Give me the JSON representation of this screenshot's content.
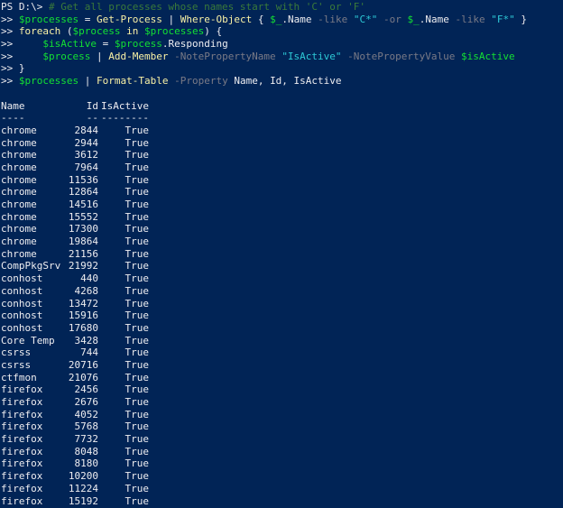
{
  "prompt": {
    "ps": "PS D:\\> ",
    "cont": ">> "
  },
  "lines": {
    "l1_comment": "# Get all processes whose names start with 'C' or 'F'",
    "l2_var": "$processes",
    "l2_eq": " = ",
    "l2_cmd": "Get-Process",
    "l2_pipe": " | ",
    "l2_cmd2": "Where-Object",
    "l2_brace": " { ",
    "l2_pvar": "$_",
    "l2_prop": ".Name ",
    "l2_like": "-like",
    "l2_sp": " ",
    "l2_str1": "\"C*\"",
    "l2_or": " -or ",
    "l2_pvar2": "$_",
    "l2_prop2": ".Name ",
    "l2_like2": "-like",
    "l2_sp2": " ",
    "l2_str2": "\"F*\"",
    "l2_close": " }",
    "l3_kw": "foreach",
    "l3_open": " (",
    "l3_var": "$process",
    "l3_in": " in ",
    "l3_var2": "$processes",
    "l3_close": ") {",
    "l4_indent": "    ",
    "l4_var": "$isActive",
    "l4_eq": " = ",
    "l4_var2": "$process",
    "l4_prop": ".Responding",
    "l5_indent": "    ",
    "l5_var": "$process",
    "l5_pipe": " | ",
    "l5_cmd": "Add-Member",
    "l5_p1": " -NotePropertyName ",
    "l5_str": "\"IsActive\"",
    "l5_p2": " -NotePropertyValue ",
    "l5_var2": "$isActive",
    "l6_close": "}",
    "l7_var": "$processes",
    "l7_pipe": " | ",
    "l7_cmd": "Format-Table",
    "l7_param": " -Property ",
    "l7_args": "Name, Id, IsActive"
  },
  "table": {
    "headers": [
      "Name",
      "Id",
      "IsActive"
    ],
    "separators": [
      "----",
      "--",
      "--------"
    ],
    "rows": [
      [
        "chrome",
        "2844",
        "True"
      ],
      [
        "chrome",
        "2944",
        "True"
      ],
      [
        "chrome",
        "3612",
        "True"
      ],
      [
        "chrome",
        "7964",
        "True"
      ],
      [
        "chrome",
        "11536",
        "True"
      ],
      [
        "chrome",
        "12864",
        "True"
      ],
      [
        "chrome",
        "14516",
        "True"
      ],
      [
        "chrome",
        "15552",
        "True"
      ],
      [
        "chrome",
        "17300",
        "True"
      ],
      [
        "chrome",
        "19864",
        "True"
      ],
      [
        "chrome",
        "21156",
        "True"
      ],
      [
        "CompPkgSrv",
        "21992",
        "True"
      ],
      [
        "conhost",
        "440",
        "True"
      ],
      [
        "conhost",
        "4268",
        "True"
      ],
      [
        "conhost",
        "13472",
        "True"
      ],
      [
        "conhost",
        "15916",
        "True"
      ],
      [
        "conhost",
        "17680",
        "True"
      ],
      [
        "Core Temp",
        "3428",
        "True"
      ],
      [
        "csrss",
        "744",
        "True"
      ],
      [
        "csrss",
        "20716",
        "True"
      ],
      [
        "ctfmon",
        "21076",
        "True"
      ],
      [
        "firefox",
        "2456",
        "True"
      ],
      [
        "firefox",
        "2676",
        "True"
      ],
      [
        "firefox",
        "4052",
        "True"
      ],
      [
        "firefox",
        "5768",
        "True"
      ],
      [
        "firefox",
        "7732",
        "True"
      ],
      [
        "firefox",
        "8048",
        "True"
      ],
      [
        "firefox",
        "8180",
        "True"
      ],
      [
        "firefox",
        "10200",
        "True"
      ],
      [
        "firefox",
        "11224",
        "True"
      ],
      [
        "firefox",
        "15192",
        "True"
      ]
    ]
  },
  "colors": {
    "background": "#012456",
    "text": "#eeedf0",
    "variable": "#13e033",
    "command": "#f9f1a5",
    "string": "#2dc9d6",
    "parameter": "#7a7a86",
    "comment": "#3a7a3a"
  }
}
